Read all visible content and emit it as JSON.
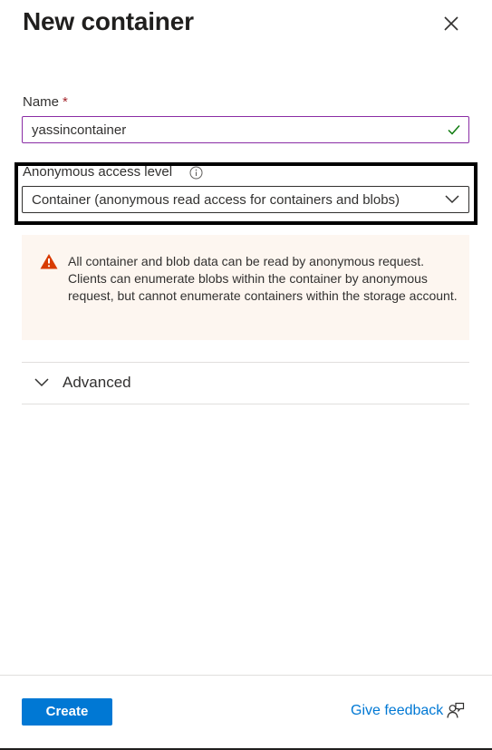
{
  "header": {
    "title": "New container",
    "close_icon": "close-icon"
  },
  "name_field": {
    "label": "Name",
    "required_marker": "*",
    "value": "yassincontainer",
    "valid_icon": "checkmark-icon"
  },
  "access_field": {
    "label": "Anonymous access level",
    "info_icon": "info-icon",
    "selected": "Container (anonymous read access for containers and blobs)",
    "dropdown_icon": "chevron-down-icon"
  },
  "warning": {
    "icon": "warning-icon",
    "text": "All container and blob data can be read by anonymous request. Clients can enumerate blobs within the container by anonymous request, but cannot enumerate containers within the storage account."
  },
  "advanced": {
    "label": "Advanced",
    "expanded": false
  },
  "footer": {
    "create_label": "Create",
    "feedback_label": "Give feedback",
    "feedback_icon": "feedback-icon"
  },
  "colors": {
    "primary": "#0078d4",
    "required": "#a4262c",
    "valid": "#107c10",
    "warning_icon": "#d83b01",
    "warning_bg": "#fdf6f0",
    "focus_border": "#8a2da5"
  }
}
